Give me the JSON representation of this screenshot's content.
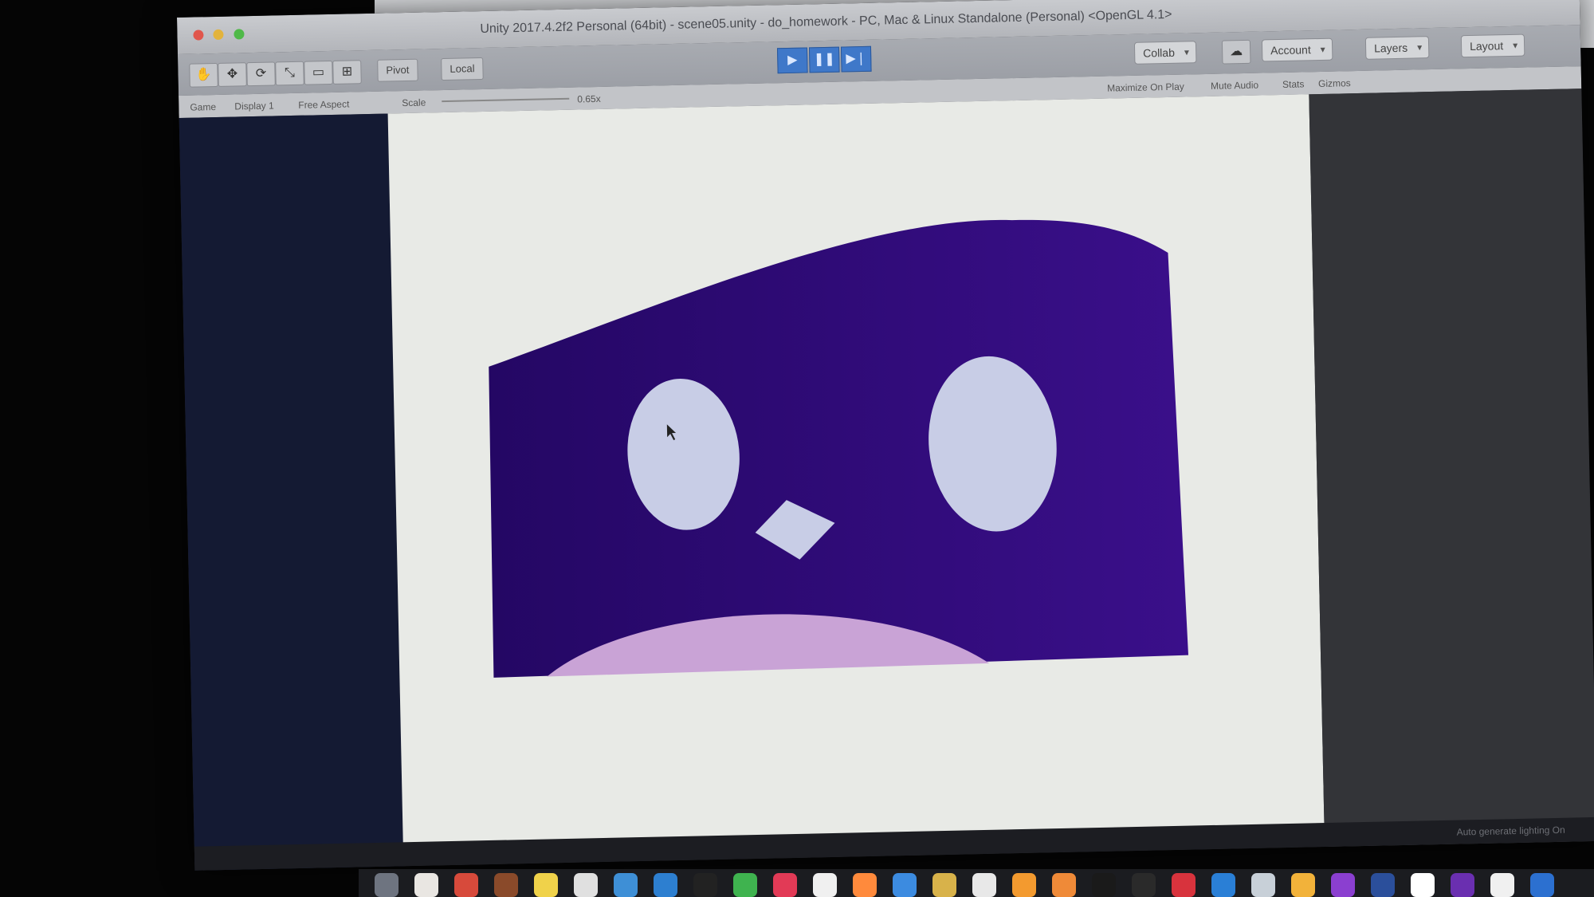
{
  "window": {
    "title": "Unity 2017.4.2f2 Personal (64bit) - scene05.unity - do_homework - PC, Mac & Linux Standalone (Personal) <OpenGL 4.1>"
  },
  "toolbar": {
    "tools": [
      "hand-tool",
      "move-tool",
      "rotate-tool",
      "scale-tool",
      "rect-tool",
      "transform-tool"
    ],
    "pivot_label": "Pivot",
    "space_label": "Local",
    "collab_label": "Collab",
    "account_label": "Account",
    "layers_label": "Layers",
    "layout_label": "Layout"
  },
  "game_tab": {
    "tab_label": "Game",
    "display_label": "Display 1",
    "aspect_label": "Free Aspect",
    "scale_label": "Scale",
    "scale_value": "0.65x",
    "maximize_label": "Maximize On Play",
    "mute_label": "Mute Audio",
    "stats_label": "Stats",
    "gizmos_label": "Gizmos"
  },
  "status": {
    "message": "Auto generate lighting On"
  },
  "scene": {
    "body_color": "#3a0f8a",
    "body_color_dark": "#240764",
    "eye_color": "#c8cde6",
    "belly_color": "#c9a3d6",
    "background_color": "#e8eae6"
  },
  "dock": {
    "colors": [
      "#6e7480",
      "#e9e6e2",
      "#d74a3b",
      "#8a4a2a",
      "#f0d24a",
      "#e0e0e0",
      "#3e8fd6",
      "#2d7fd0",
      "#222222",
      "#3fb34f",
      "#e23a56",
      "#f0f0f0",
      "#ff8a3c",
      "#3c8be0",
      "#d8b24a",
      "#e8e8e8",
      "#f39a2f",
      "#ef8a38",
      "#1a1a1a",
      "#2a2a2a",
      "#d8333d",
      "#2a7fd6",
      "#c8d0d8",
      "#f2b23a",
      "#8b3fd0",
      "#2b4f9b",
      "#ffffff",
      "#6a2fb0",
      "#f0f0f0",
      "#2c70d0"
    ]
  }
}
